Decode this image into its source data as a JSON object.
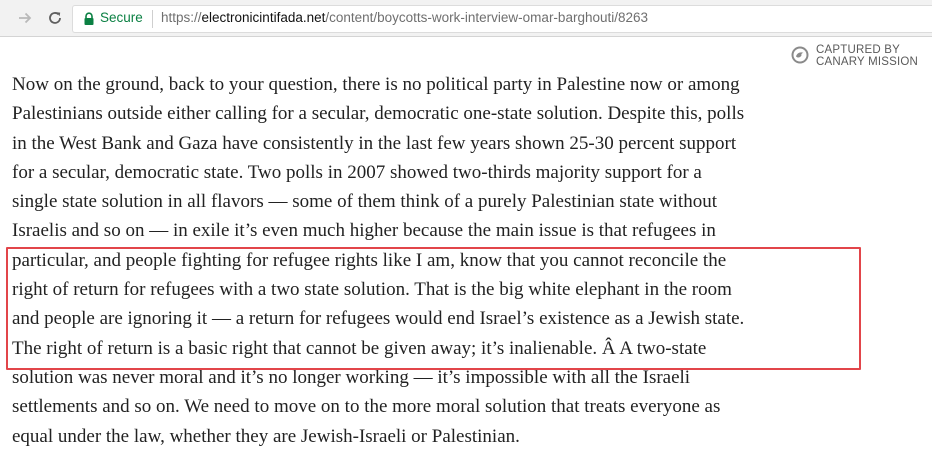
{
  "browser": {
    "secure_label": "Secure",
    "url_scheme": "https://",
    "url_host": "electronicintifada.net",
    "url_path": "/content/boycotts-work-interview-omar-barghouti/8263"
  },
  "watermark": {
    "line1": "CAPTURED BY",
    "line2": "CANARY MISSION"
  },
  "article": {
    "lines": [
      "Now on the ground, back to your question, there is no political party in Palestine now or among",
      "Palestinians outside either calling for a secular, democratic one-state solution. Despite this, polls",
      "in the West Bank and Gaza have consistently in the last few years shown 25-30 percent support",
      "for a secular, democratic state. Two polls in 2007 showed two-thirds majority support for a",
      "single state solution in all flavors — some of them think of a purely Palestinian state without",
      "Israelis and so on — in exile it’s even much higher because the main issue is that refugees in",
      "particular, and people fighting for refugee rights like I am, know that you cannot reconcile the",
      "right of return for refugees with a two state solution. That is the big white elephant in the room",
      "and people are ignoring it — a return for refugees would end Israel’s existence as a Jewish state.",
      "The right of return is a basic right that cannot be given away; it’s inalienable. Â A two-state",
      "solution was never moral and it’s no longer working — it’s impossible with all the Israeli",
      "settlements and so on. We need to move on to the more moral solution that treats everyone as",
      "equal under the law, whether they are Jewish-Israeli or Palestinian."
    ]
  },
  "colors": {
    "highlight_border": "#e2454a",
    "secure_green": "#0b8043"
  },
  "icons": [
    "forward-arrow-icon",
    "reload-icon",
    "lock-icon",
    "canary-logo-icon"
  ]
}
